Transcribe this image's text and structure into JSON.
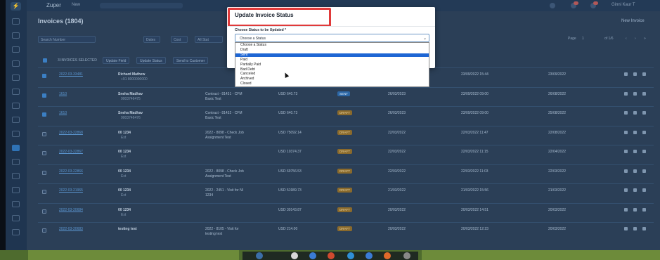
{
  "app": {
    "name": "Zuper",
    "new_menu": "New",
    "user_menu": "Ginni Kaur T"
  },
  "page": {
    "title": "Invoices (1804)",
    "new_button": "New Invoice"
  },
  "filters": {
    "search_placeholder": "Search Number",
    "f1": "Dates",
    "f2": "Cost",
    "f3": "All Stat",
    "page_label": "Page",
    "page_value": "1",
    "of_label": "of 1/6"
  },
  "actions": {
    "selected": "3 INVOICES SELECTED",
    "update_field": "Update Field",
    "update_status": "Update Status",
    "send": "Send to Customer"
  },
  "modal": {
    "title": "Update Invoice Status",
    "field_label": "Choose Status to be Updated *",
    "select_value": "Choose a Status",
    "options": [
      "Choose a Status",
      "Draft",
      "Sent",
      "Paid",
      "Partially Paid",
      "Bad Debt",
      "Canceled",
      "Archived",
      "Closed"
    ],
    "selected_option": "Sent"
  },
  "rows": [
    {
      "number": "2022-03-33481",
      "customer": "Richard Mathew",
      "phone": "+91 8000000000",
      "job": "",
      "amount": "",
      "status": "",
      "due": "",
      "created": "23/09/2022 15:44",
      "updated": "23/09/2022",
      "checked": true
    },
    {
      "number": "1610",
      "customer": "Sneha Madhav",
      "phone": "9003746475",
      "job": "Contract - 81431 - CFM Basic Test",
      "amount": "USD 640.73",
      "status": "SENT",
      "due": "26/03/2023",
      "created": "23/09/2022 09:00",
      "updated": "26/08/2022",
      "checked": true
    },
    {
      "number": "1610",
      "customer": "Sneha Madhav",
      "phone": "9003746476",
      "job": "Contract - 81432 - CFM Basic Test",
      "amount": "USD 640.73",
      "status": "DRAFT",
      "due": "26/03/2023",
      "created": "23/09/2022 09:00",
      "updated": "25/08/2022",
      "checked": true
    },
    {
      "number": "2022-03-22868",
      "customer": "00 1234",
      "phone": "Ext",
      "job": "2022 - 8098 - Check Job Assignment Test",
      "amount": "USD 75092.14",
      "status": "DRAFT",
      "due": "22/03/2022",
      "created": "22/03/2022 11:47",
      "updated": "22/08/2022",
      "checked": false
    },
    {
      "number": "2022-03-22867",
      "customer": "00 1234",
      "phone": "Ext",
      "job": "",
      "amount": "USD 10374.37",
      "status": "DRAFT",
      "due": "22/03/2022",
      "created": "22/03/2022 11:15",
      "updated": "22/04/2022",
      "checked": false
    },
    {
      "number": "2022-03-22866",
      "customer": "00 1234",
      "phone": "Ext",
      "job": "2022 - 8098 - Check Job Assignment Test",
      "amount": "USD 69756.53",
      "status": "DRAFT",
      "due": "22/03/2022",
      "created": "22/03/2022 11:03",
      "updated": "22/03/2022",
      "checked": false
    },
    {
      "number": "2022-03-21965",
      "customer": "00 1234",
      "phone": "Ext",
      "job": "2022 - 2451 - Visit for NI 1234",
      "amount": "USD 51989.73",
      "status": "DRAFT",
      "due": "21/03/2022",
      "created": "21/03/2022 15:56",
      "updated": "21/03/2022",
      "checked": false
    },
    {
      "number": "2022-03-20684",
      "customer": "00 1234",
      "phone": "Ext",
      "job": "",
      "amount": "USD 30143.87",
      "status": "DRAFT",
      "due": "20/03/2022",
      "created": "20/03/2022 14:51",
      "updated": "20/03/2022",
      "checked": false
    },
    {
      "number": "2022-03-20683",
      "customer": "testing test",
      "phone": "",
      "job": "2022 - 8105 - Visit for testing test",
      "amount": "USD 214.00",
      "status": "DRAFT",
      "due": "20/03/2022",
      "created": "20/03/2022 12:23",
      "updated": "20/03/2022",
      "checked": false
    }
  ],
  "colors": {
    "accent": "#2f73b6",
    "highlight": "#e03a3a",
    "selected_option": "#1e66d4"
  }
}
